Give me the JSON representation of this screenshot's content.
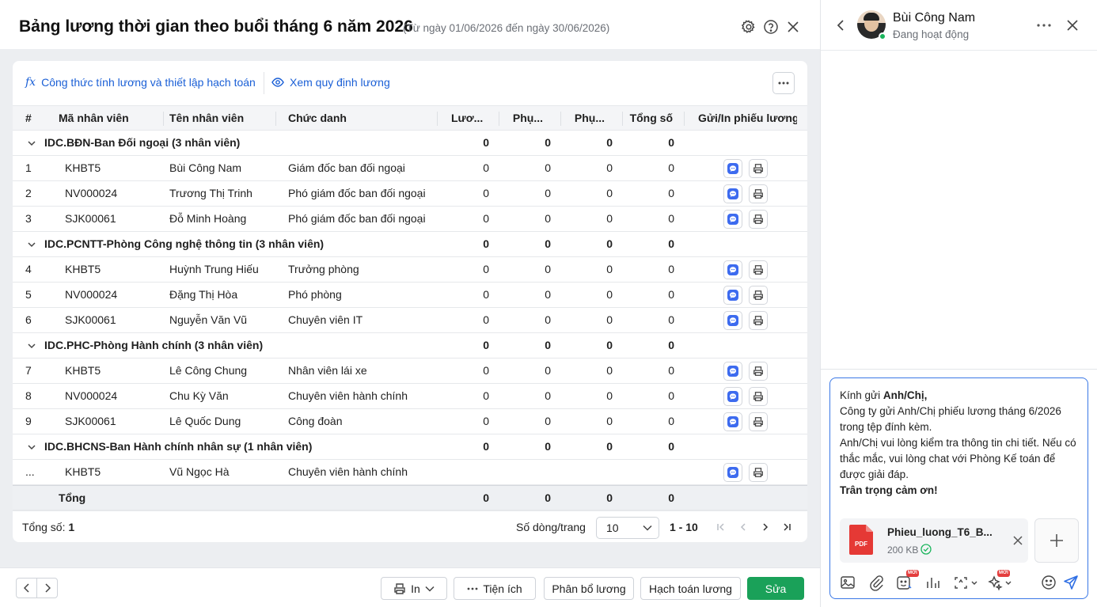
{
  "header": {
    "title": "Bảng lương thời gian theo buổi tháng 6 năm 2026",
    "subtitle": "(Từ ngày 01/06/2026 đến ngày 30/06/2026)"
  },
  "toolbar": {
    "formula_link": "Công thức tính lương và thiết lập hạch toán",
    "rules_link": "Xem quy định lương"
  },
  "table": {
    "columns": [
      "#",
      "Mã nhân viên",
      "Tên nhân viên",
      "Chức danh",
      "Lươ...",
      "Phụ...",
      "Phụ...",
      "Tổng số",
      "Gửi/In phiếu lương"
    ],
    "groups": [
      {
        "name": "IDC.BĐN-Ban Đối ngoại (3 nhân viên)",
        "totals": [
          "0",
          "0",
          "0",
          "0"
        ],
        "rows": [
          {
            "no": "1",
            "code": "KHBT5",
            "name": "Bùi Công Nam",
            "title": "Giám đốc ban đối ngoại",
            "v": [
              "0",
              "0",
              "0",
              "0"
            ]
          },
          {
            "no": "2",
            "code": "NV000024",
            "name": "Trương Thị Trinh",
            "title": "Phó giám đốc ban đối ngoại",
            "v": [
              "0",
              "0",
              "0",
              "0"
            ]
          },
          {
            "no": "3",
            "code": "SJK00061",
            "name": "Đỗ Minh Hoàng",
            "title": "Phó giám đốc ban đối ngoại",
            "v": [
              "0",
              "0",
              "0",
              "0"
            ]
          }
        ]
      },
      {
        "name": "IDC.PCNTT-Phòng Công nghệ thông tin (3 nhân viên)",
        "totals": [
          "0",
          "0",
          "0",
          "0"
        ],
        "rows": [
          {
            "no": "4",
            "code": "KHBT5",
            "name": "Huỳnh Trung Hiếu",
            "title": "Trưởng phòng",
            "v": [
              "0",
              "0",
              "0",
              "0"
            ]
          },
          {
            "no": "5",
            "code": "NV000024",
            "name": "Đặng Thị Hòa",
            "title": "Phó phòng",
            "v": [
              "0",
              "0",
              "0",
              "0"
            ]
          },
          {
            "no": "6",
            "code": "SJK00061",
            "name": "Nguyễn Văn Vũ",
            "title": "Chuyên viên IT",
            "v": [
              "0",
              "0",
              "0",
              "0"
            ]
          }
        ]
      },
      {
        "name": "IDC.PHC-Phòng Hành chính (3 nhân viên)",
        "totals": [
          "0",
          "0",
          "0",
          "0"
        ],
        "rows": [
          {
            "no": "7",
            "code": "KHBT5",
            "name": "Lê Công Chung",
            "title": "Nhân viên lái xe",
            "v": [
              "0",
              "0",
              "0",
              "0"
            ]
          },
          {
            "no": "8",
            "code": "NV000024",
            "name": "Chu Kỳ Văn",
            "title": "Chuyên viên hành chính",
            "v": [
              "0",
              "0",
              "0",
              "0"
            ]
          },
          {
            "no": "9",
            "code": "SJK00061",
            "name": "Lê Quốc Dung",
            "title": "Công đoàn",
            "v": [
              "0",
              "0",
              "0",
              "0"
            ]
          }
        ]
      },
      {
        "name": "IDC.BHCNS-Ban Hành chính nhân sự (1 nhân viên)",
        "totals": [
          "0",
          "0",
          "0",
          "0"
        ],
        "rows": [
          {
            "no": "...",
            "code": "KHBT5",
            "name": "Vũ Ngọc Hà",
            "title": "Chuyên viên hành chính",
            "v": [
              "",
              "",
              "",
              ""
            ]
          }
        ]
      }
    ],
    "total_row": {
      "label": "Tổng",
      "values": [
        "0",
        "0",
        "0",
        "0"
      ]
    }
  },
  "footer": {
    "count_label": "Tổng số:",
    "count_value": "1",
    "rows_per_page_label": "Số dòng/trang",
    "rows_per_page": "10",
    "range": "1 - 10"
  },
  "bottom_bar": {
    "print": "In",
    "utilities": "Tiện ích",
    "allocate": "Phân bổ lương",
    "accounting": "Hạch toán lương",
    "edit": "Sửa"
  },
  "chat": {
    "contact_name": "Bùi Công Nam",
    "contact_status": "Đang hoạt động",
    "message": {
      "greeting_prefix": "Kính gửi ",
      "greeting_bold": "Anh/Chị,",
      "line2": "Công ty gửi Anh/Chị phiếu lương tháng 6/2026 trong tệp đính kèm.",
      "line3": "Anh/Chị vui lòng kiểm tra thông tin chi tiết. Nếu có thắc mắc, vui lòng chat với Phòng Kế toán để được giải đáp.",
      "closing": "Trân trọng cảm ơn!"
    },
    "attachment": {
      "name": "Phieu_luong_T6_B...",
      "size": "200 KB",
      "type_label": "PDF"
    },
    "badge_new": "MỚI"
  },
  "colors": {
    "accent": "#1a5fd6",
    "primary_button": "#1aa159",
    "pdf": "#e53935",
    "online": "#1ab55c"
  }
}
